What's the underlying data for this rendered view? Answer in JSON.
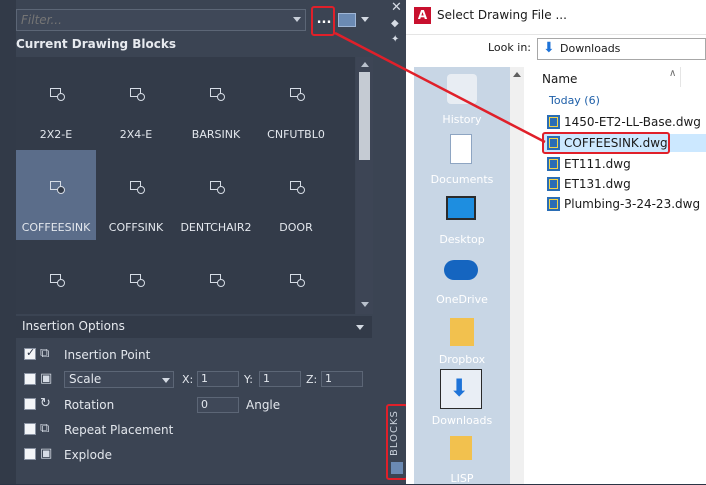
{
  "palette": {
    "filter_placeholder": "Filter...",
    "more_button_label": "...",
    "section_title": "Current Drawing Blocks",
    "blocks": [
      {
        "name": "2X2-E",
        "selected": false
      },
      {
        "name": "2X4-E",
        "selected": false
      },
      {
        "name": "BARSINK",
        "selected": false
      },
      {
        "name": "CNFUTBL0",
        "selected": false
      },
      {
        "name": "COFFEESINK",
        "selected": true
      },
      {
        "name": "COFFSINK",
        "selected": false
      },
      {
        "name": "DENTCHAIR2",
        "selected": false
      },
      {
        "name": "DOOR",
        "selected": false
      },
      {
        "name": "",
        "selected": false
      },
      {
        "name": "",
        "selected": false
      },
      {
        "name": "",
        "selected": false
      },
      {
        "name": "",
        "selected": false
      }
    ],
    "insertion_options": {
      "title": "Insertion Options",
      "insertion_point": {
        "label": "Insertion Point",
        "checked": true
      },
      "scale": {
        "checked": false,
        "mode": "Scale",
        "x_label": "X:",
        "x": "1",
        "y_label": "Y:",
        "y": "1",
        "z_label": "Z:",
        "z": "1"
      },
      "rotation": {
        "label": "Rotation",
        "checked": false,
        "value": "0",
        "angle_label": "Angle"
      },
      "repeat_placement": {
        "label": "Repeat Placement",
        "checked": false
      },
      "explode": {
        "label": "Explode",
        "checked": false
      }
    },
    "vertical_tab": "BLOCKS"
  },
  "dialog": {
    "title": "Select Drawing File ...",
    "app_icon_letter": "A",
    "look_in_label": "Look in:",
    "look_in_value": "Downloads",
    "places": [
      "History",
      "Documents",
      "Desktop",
      "OneDrive",
      "Dropbox",
      "Downloads",
      "LISP"
    ],
    "selected_place": "Downloads",
    "column_name": "Name",
    "group_label": "Today (6)",
    "files": [
      {
        "name": "1450-ET2-LL-Base.dwg",
        "selected": false
      },
      {
        "name": "COFFEESINK.dwg",
        "selected": true
      },
      {
        "name": "ET111.dwg",
        "selected": false
      },
      {
        "name": "ET131.dwg",
        "selected": false
      },
      {
        "name": "Plumbing-3-24-23.dwg",
        "selected": false
      }
    ]
  },
  "colors": {
    "palette_bg": "#3b4453",
    "selection_blue": "#5b6d8a",
    "annotation_red": "#e0202a",
    "places_bg": "#c8d6e5",
    "file_selected_bg": "#cce8ff"
  }
}
